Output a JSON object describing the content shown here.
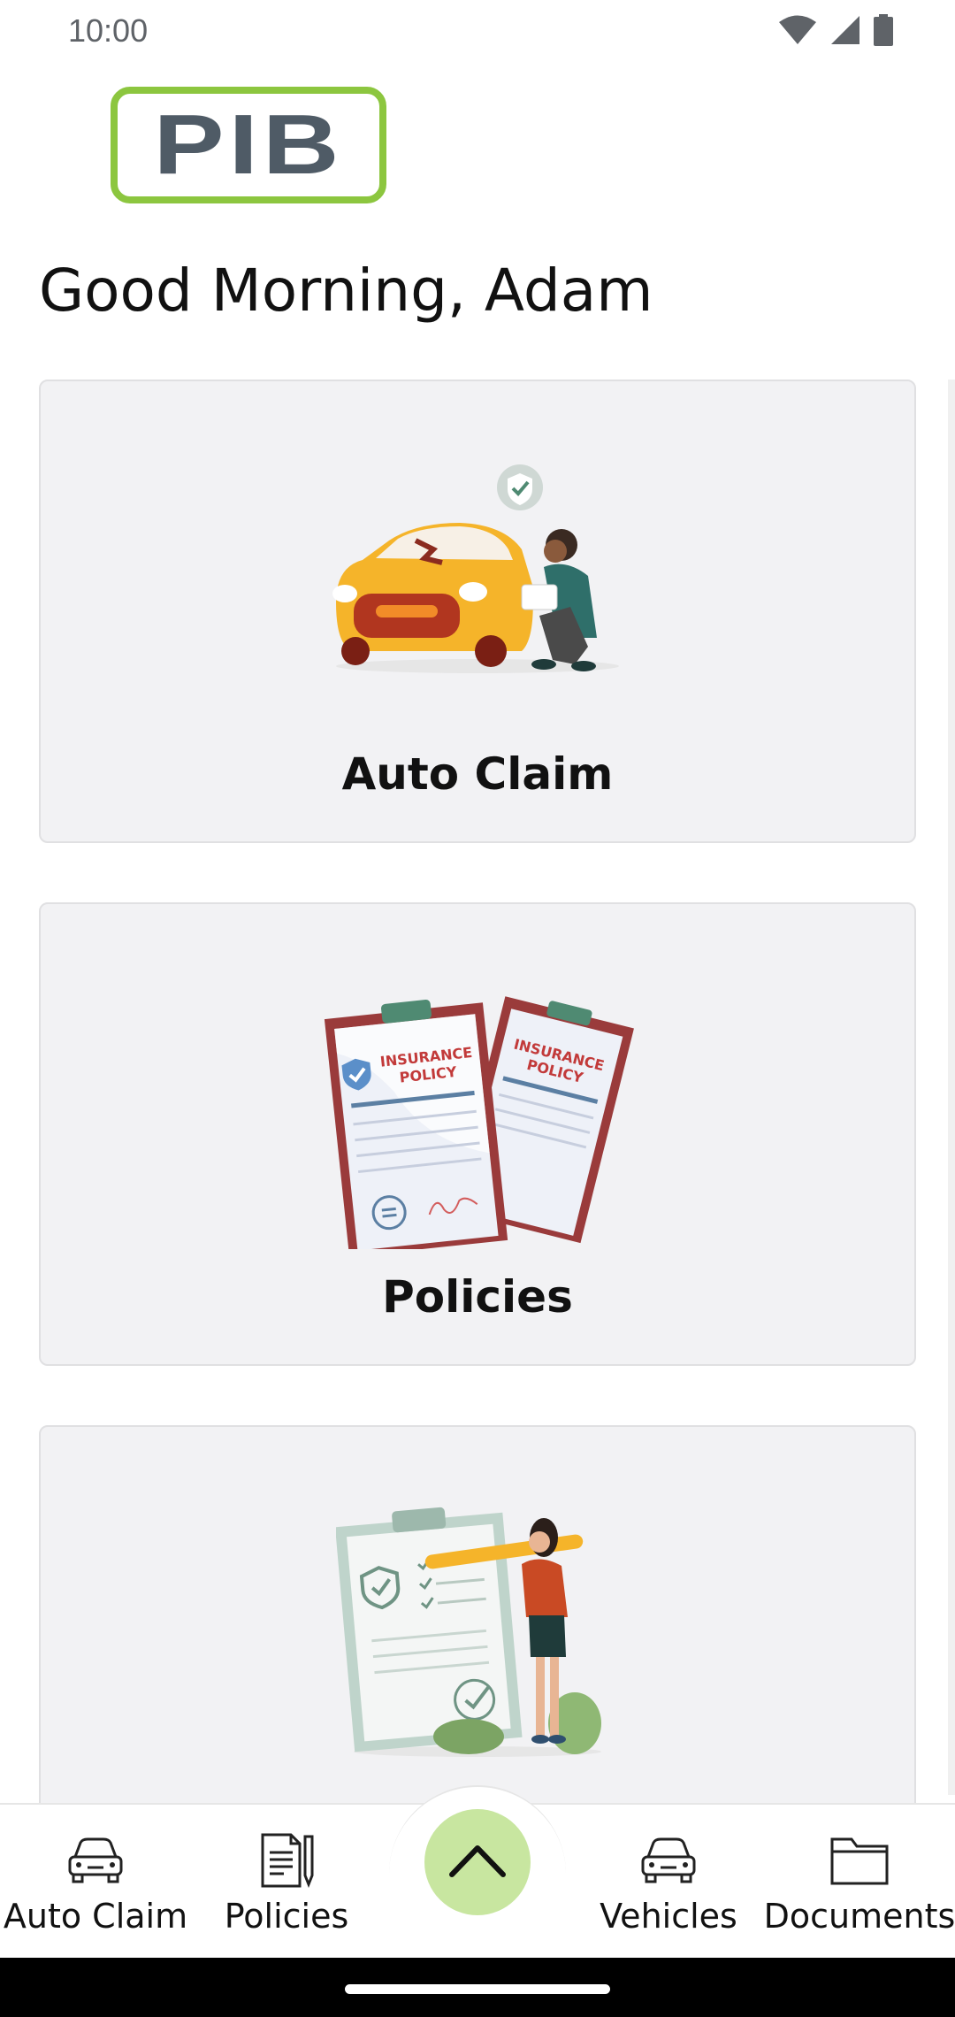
{
  "status_bar": {
    "time": "10:00",
    "icons": [
      "wifi-icon",
      "signal-icon",
      "battery-icon"
    ]
  },
  "logo": {
    "text": "PIB",
    "border_color": "#8cc63f",
    "text_color": "#4f5b66"
  },
  "greeting": "Good Morning, Adam",
  "cards": [
    {
      "label": "Auto Claim",
      "illustration": "car-damage-inspection-illustration"
    },
    {
      "label": "Policies",
      "illustration": "insurance-policy-documents-illustration",
      "illustration_text": [
        "INSURANCE",
        "POLICY"
      ]
    },
    {
      "label": "",
      "illustration": "checklist-woman-pencil-illustration"
    }
  ],
  "bottom_nav": {
    "items": [
      {
        "label": "Auto Claim",
        "icon": "car-icon"
      },
      {
        "label": "Policies",
        "icon": "document-pencil-icon"
      },
      {
        "label": "Vehicles",
        "icon": "car-icon"
      },
      {
        "label": "Documents",
        "icon": "folder-icon"
      }
    ],
    "fab_icon": "chevron-up-icon",
    "fab_color": "#c8e6a0"
  }
}
